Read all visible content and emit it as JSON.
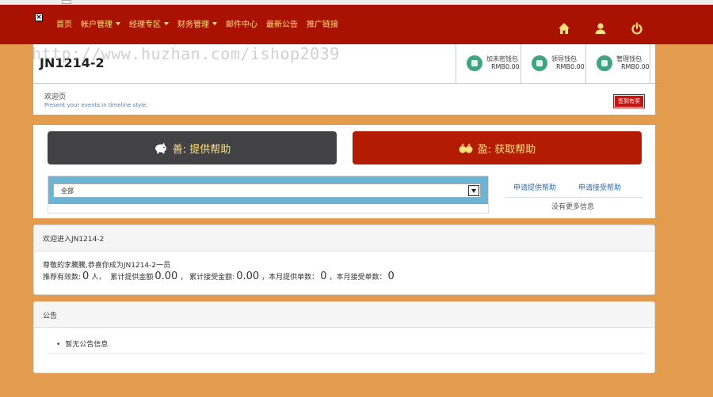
{
  "nav": {
    "close_glyph": "×",
    "items": [
      {
        "label": "首页",
        "dropdown": false
      },
      {
        "label": "帐户管理",
        "dropdown": true
      },
      {
        "label": "经理专区",
        "dropdown": true
      },
      {
        "label": "财务管理",
        "dropdown": true
      },
      {
        "label": "邮件中心",
        "dropdown": false
      },
      {
        "label": "最新公告",
        "dropdown": false
      },
      {
        "label": "推广链接",
        "dropdown": false
      }
    ],
    "icons": [
      "home-icon",
      "user-icon",
      "power-icon"
    ],
    "bar_color": "#a91200",
    "text_color": "#ffe07a"
  },
  "header": {
    "title": "JN1214-2",
    "watermark": "http://www.huzhan.com/ishop2039",
    "wallets": [
      {
        "name": "加未密钱包",
        "amount": "RMB0.00",
        "icon": "shield-icon"
      },
      {
        "name": "领导钱包",
        "amount": "RMB0.00",
        "icon": "team-icon"
      },
      {
        "name": "管理钱包",
        "amount": "RMB0.00",
        "icon": "users-icon"
      }
    ]
  },
  "welcome": {
    "title": "欢迎页",
    "subtitle": "Present your events in timeline style.",
    "sign_button": "签到有奖"
  },
  "help": {
    "give_label": "善: 提供帮助",
    "get_label": "盈: 获取帮助",
    "give_color": "#424244",
    "get_color": "#b31c03",
    "filter_selected": "全部",
    "apply_give": "申请提供帮助",
    "apply_get": "申请接受帮助",
    "empty_text": "没有更多信息"
  },
  "info": {
    "heading": "欢迎进入JN1214-2",
    "greeting": "尊敬的李騰騰,恭喜你成为JN1214-2一员",
    "referrals_label": "推荐有效数:",
    "referrals_value": "0",
    "referrals_unit": "人，",
    "total_give_label": "累计提供金额",
    "total_give_value": "0.00",
    "total_get_label": "，  累计接受金额:",
    "total_get_value": "0.00",
    "month_give_label": "，本月提供单数：",
    "month_give_value": "0",
    "month_get_label": "，本月接受单数：",
    "month_get_value": "0"
  },
  "notice": {
    "heading": "公告",
    "empty_item": "暂无公告信息"
  },
  "page": {
    "background": "#e39c4e"
  }
}
